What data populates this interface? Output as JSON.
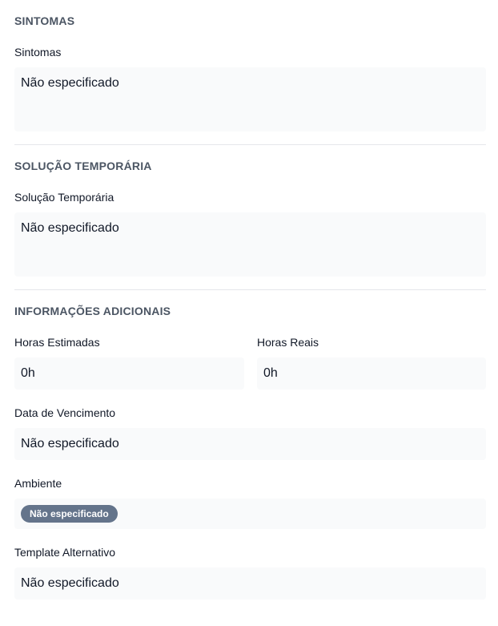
{
  "sections": {
    "sintomas": {
      "title": "SINTOMAS",
      "label": "Sintomas",
      "value": "Não especificado"
    },
    "solucao": {
      "title": "SOLUÇÃO TEMPORÁRIA",
      "label": "Solução Temporária",
      "value": "Não especificado"
    },
    "info": {
      "title": "INFORMAÇÕES ADICIONAIS",
      "horas_estimadas_label": "Horas Estimadas",
      "horas_estimadas_value": "0h",
      "horas_reais_label": "Horas Reais",
      "horas_reais_value": "0h",
      "data_vencimento_label": "Data de Vencimento",
      "data_vencimento_value": "Não especificado",
      "ambiente_label": "Ambiente",
      "ambiente_badge": "Não especificado",
      "template_label": "Template Alternativo",
      "template_value": "Não especificado"
    }
  },
  "colors": {
    "badge_bg": "#64748b",
    "field_bg": "#f9fafb",
    "section_title": "#4b5563",
    "divider": "#e5e7eb"
  }
}
